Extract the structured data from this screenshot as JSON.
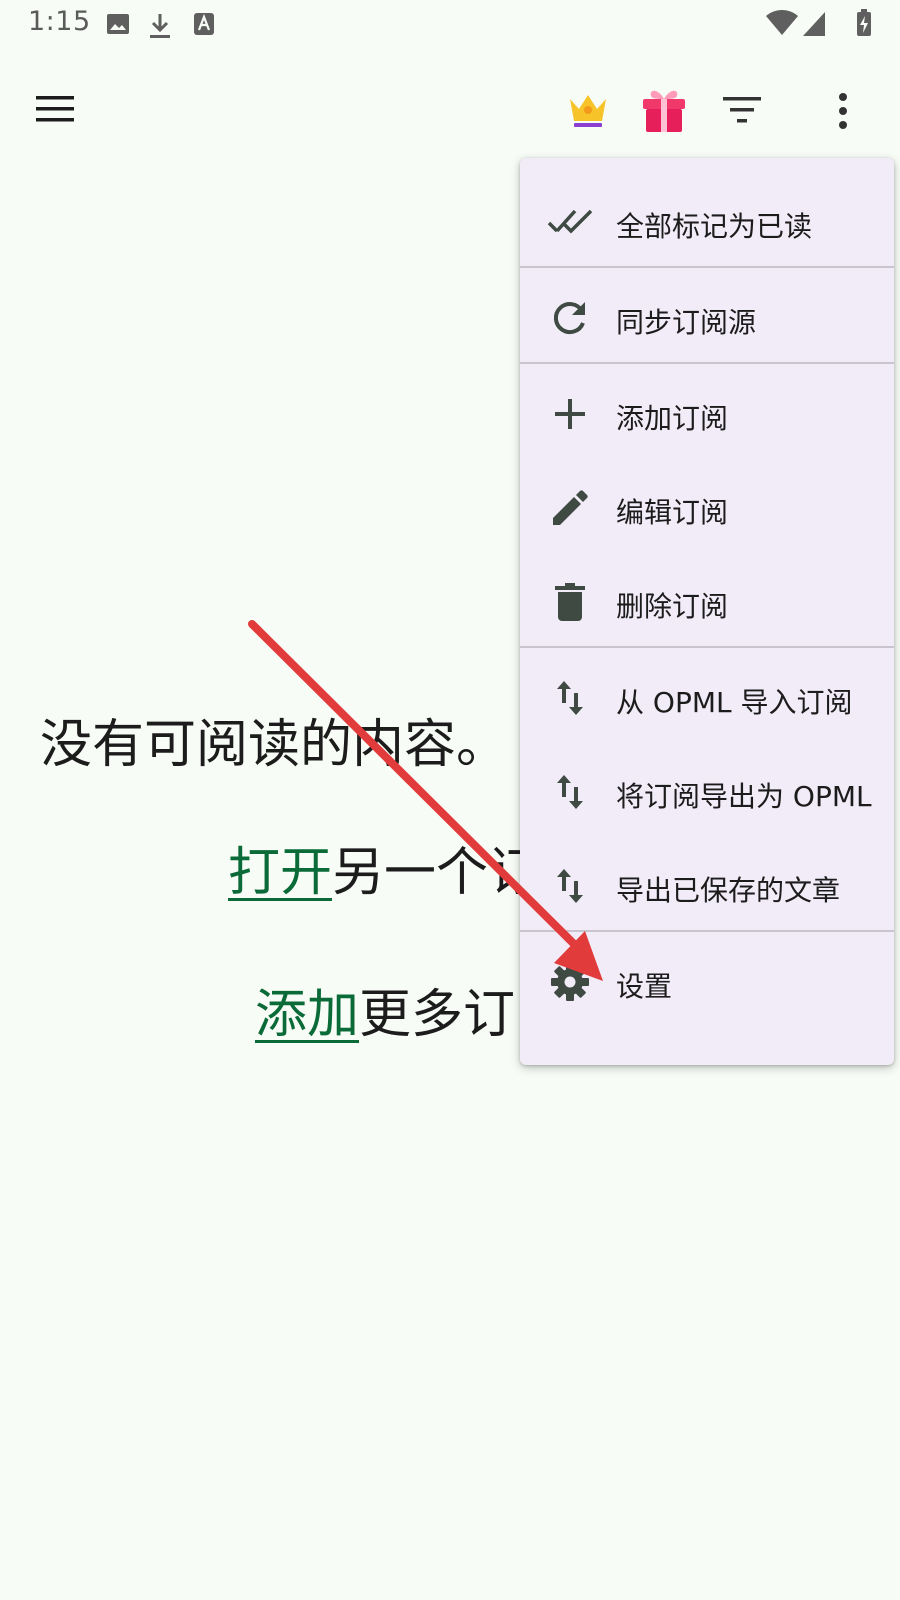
{
  "status_bar": {
    "time": "1:15"
  },
  "empty_state": {
    "title": "没有可阅读的内容。",
    "open_link": "打开",
    "open_rest": "另一个订",
    "add_link": "添加",
    "add_rest": "更多订"
  },
  "menu": {
    "items": [
      {
        "label": "全部标记为已读",
        "icon": "done-all-icon"
      },
      {
        "label": "同步订阅源",
        "icon": "refresh-icon"
      },
      {
        "label": "添加订阅",
        "icon": "plus-icon"
      },
      {
        "label": "编辑订阅",
        "icon": "pencil-icon"
      },
      {
        "label": "删除订阅",
        "icon": "trash-icon"
      },
      {
        "label": "从 OPML 导入订阅",
        "icon": "import-export-icon"
      },
      {
        "label": "将订阅导出为 OPML",
        "icon": "import-export-icon"
      },
      {
        "label": "导出已保存的文章",
        "icon": "import-export-icon"
      },
      {
        "label": "设置",
        "icon": "gear-icon"
      }
    ]
  },
  "colors": {
    "background": "#f8fcf6",
    "menu_background": "#f1ecf7",
    "link": "#0b6b38",
    "annotation_arrow": "#e23b3b",
    "icon": "#3e4a42"
  }
}
